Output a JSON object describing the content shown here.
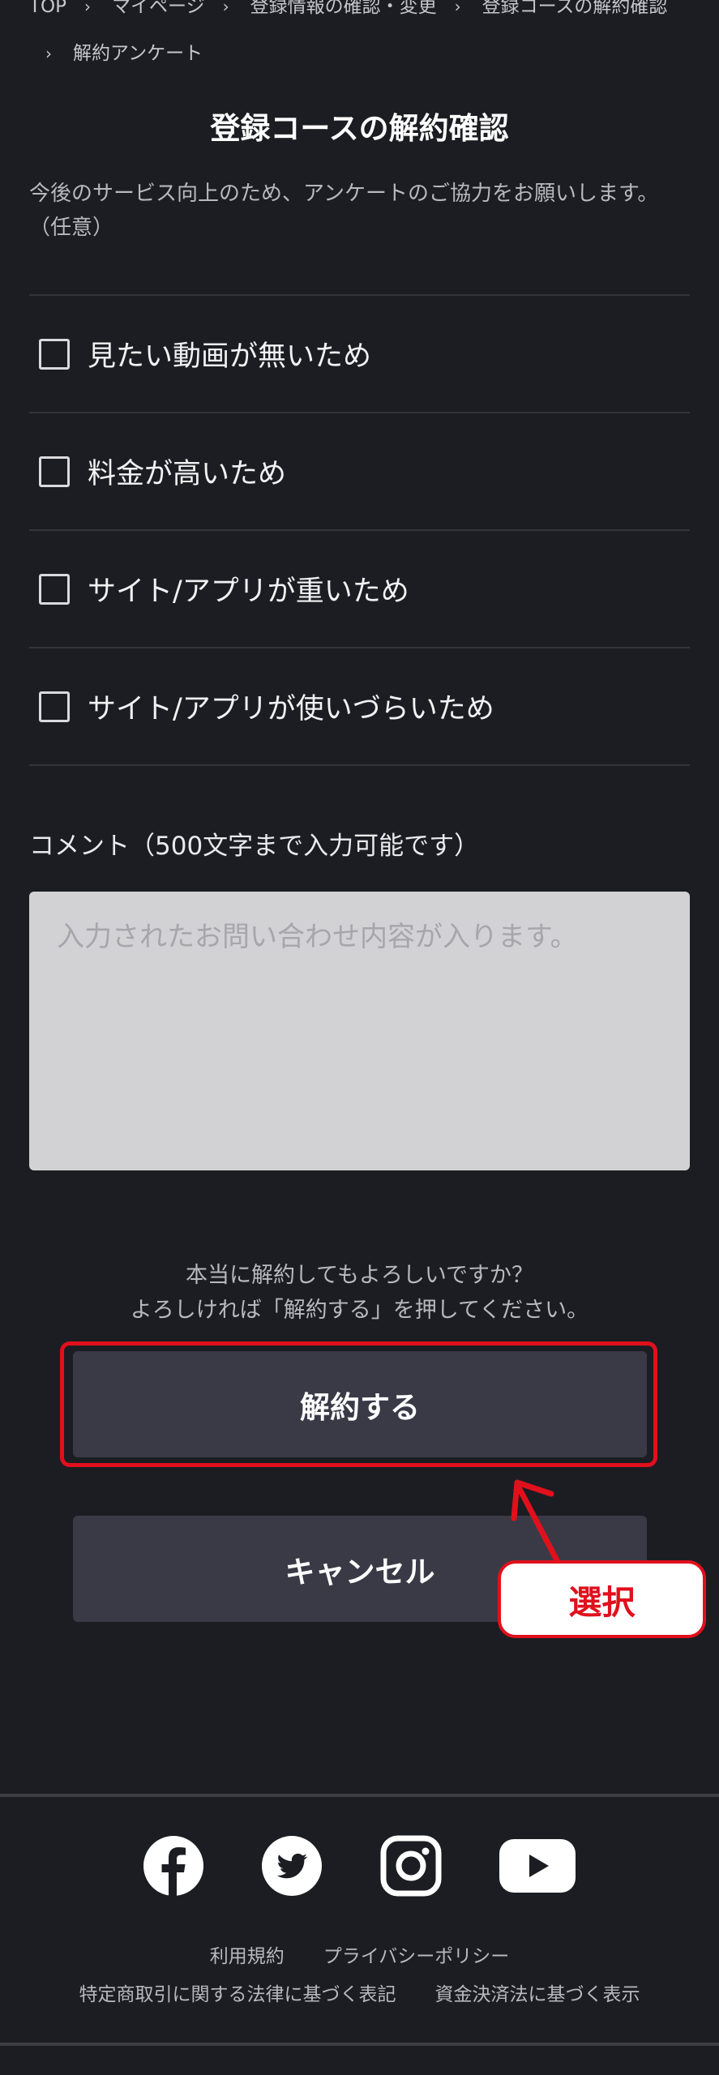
{
  "breadcrumb": {
    "row1": [
      "TOP",
      "マイページ",
      "登録情報の確認・変更",
      "登録コースの解約確認"
    ],
    "row2": [
      "解約アンケート"
    ]
  },
  "page_title": "登録コースの解約確認",
  "lead_text": "今後のサービス向上のため、アンケートのご協力をお願いします。（任意）",
  "survey_options": [
    {
      "label": "見たい動画が無いため",
      "checked": false
    },
    {
      "label": "料金が高いため",
      "checked": false
    },
    {
      "label": "サイト/アプリが重いため",
      "checked": false
    },
    {
      "label": "サイト/アプリが使いづらいため",
      "checked": false
    }
  ],
  "comment": {
    "label": "コメント（500文字まで入力可能です）",
    "placeholder": "入力されたお問い合わせ内容が入ります。",
    "value": ""
  },
  "confirm": {
    "line1": "本当に解約してもよろしいですか？",
    "line2": "よろしければ「解約する」を押してください。",
    "confirm_button": "解約する",
    "cancel_button": "キャンセル"
  },
  "annotation": {
    "callout_label": "選択",
    "color": "#e0101c"
  },
  "footer": {
    "social": [
      "facebook-icon",
      "twitter-icon",
      "instagram-icon",
      "youtube-icon"
    ],
    "links_row1": [
      "利用規約",
      "プライバシーポリシー"
    ],
    "links_row2": [
      "特定商取引に関する法律に基づく表記",
      "資金決済法に基づく表示"
    ]
  },
  "colors": {
    "background": "#1c1d22",
    "button": "#3a3a47",
    "accent_red": "#e0101c",
    "input_bg": "#d2d2d5"
  }
}
